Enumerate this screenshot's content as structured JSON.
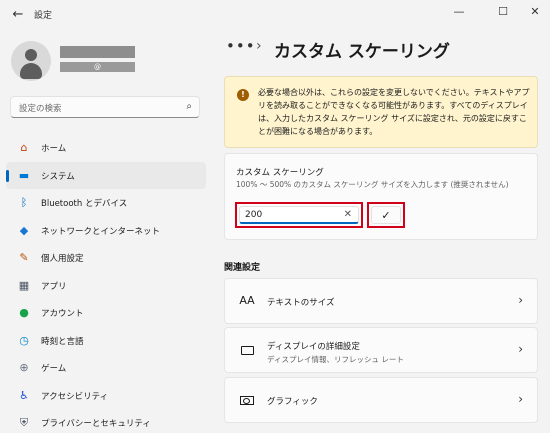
{
  "window": {
    "title": "設定",
    "back_glyph": "←",
    "min_glyph": "—",
    "max_glyph": "☐",
    "close_glyph": "✕"
  },
  "user": {
    "email_fragment": "@"
  },
  "search": {
    "placeholder": "設定の検索",
    "icon": "search-icon"
  },
  "nav": {
    "items": [
      {
        "label": "ホーム",
        "icon": "home-icon",
        "glyph": "⌂",
        "color": "#c2410c"
      },
      {
        "label": "システム",
        "icon": "monitor-icon",
        "glyph": "▬",
        "color": "#0078d4",
        "selected": true
      },
      {
        "label": "Bluetooth とデバイス",
        "icon": "bluetooth-icon",
        "glyph": "ᛒ",
        "color": "#0067c0"
      },
      {
        "label": "ネットワークとインターネット",
        "icon": "wifi-icon",
        "glyph": "◆",
        "color": "#1976d2"
      },
      {
        "label": "個人用設定",
        "icon": "brush-icon",
        "glyph": "✎",
        "color": "#b45309"
      },
      {
        "label": "アプリ",
        "icon": "apps-icon",
        "glyph": "▦",
        "color": "#4b5563"
      },
      {
        "label": "アカウント",
        "icon": "account-icon",
        "glyph": "●",
        "color": "#16a34a"
      },
      {
        "label": "時刻と言語",
        "icon": "clock-globe-icon",
        "glyph": "◷",
        "color": "#0284c7"
      },
      {
        "label": "ゲーム",
        "icon": "gamepad-icon",
        "glyph": "⊕",
        "color": "#6b7280"
      },
      {
        "label": "アクセシビリティ",
        "icon": "accessibility-icon",
        "glyph": "♿",
        "color": "#1d4ed8"
      },
      {
        "label": "プライバシーとセキュリティ",
        "icon": "shield-icon",
        "glyph": "⛨",
        "color": "#4b5563"
      }
    ]
  },
  "breadcrumb": {
    "more": "•••",
    "separator": "›",
    "title": "カスタム スケーリング"
  },
  "warning": {
    "icon": "warning-icon",
    "glyph": "!",
    "text": "必要な場合以外は、これらの設定を変更しないでください。テキストやアプリを読み取ることができなくなる可能性があります。すべてのディスプレイは、入力したカスタム スケーリング サイズに設定され、元の設定に戻すことが困難になる場合があります。"
  },
  "custom_scaling": {
    "title": "カスタム スケーリング",
    "description": "100% ～ 500% のカスタム スケーリング サイズを入力します (推奨されません)",
    "value": "200",
    "clear_glyph": "✕",
    "apply_glyph": "✓"
  },
  "related": {
    "heading": "関連設定",
    "items": [
      {
        "label": "テキストのサイズ",
        "icon": "text-size-icon",
        "glyph": "AA"
      },
      {
        "label": "ディスプレイの詳細設定",
        "description": "ディスプレイ情報、リフレッシュ レート",
        "icon": "monitor-icon"
      },
      {
        "label": "グラフィック",
        "icon": "graphics-card-icon"
      }
    ],
    "chevron": "›"
  },
  "colors": {
    "accent": "#0067c0",
    "highlight_box": "#d0021b",
    "warning_bg": "#fff4ce"
  }
}
